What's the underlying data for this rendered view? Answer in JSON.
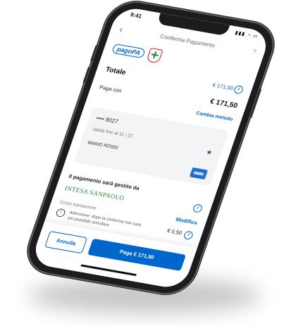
{
  "status": {
    "time": "9:41"
  },
  "nav": {
    "title": "Conferma Pagamento",
    "back_icon": "chevron-left-icon",
    "help": "?"
  },
  "logos": {
    "pagopa": "pagoPA"
  },
  "totale": {
    "label": "Totale",
    "amount": "€ 171,00"
  },
  "paga_con": {
    "label": "Paga con",
    "amount": "€ 171,50",
    "change_label": "Cambia metodo"
  },
  "card": {
    "number": "•••• 8027",
    "expiry": "Valida fino al 11 / 22",
    "holder": "MARIO ROSSI"
  },
  "gestito": {
    "label": "Il pagamento sarà gestito da",
    "bank": "INTESA SANPAOLO"
  },
  "costo": {
    "label": "Costo transazione",
    "edit_label": "Modifica",
    "fee": "€ 0,50"
  },
  "warning": {
    "text": "Attenzione: dopo la conferma non sarà più possibile annullare."
  },
  "footer": {
    "cancel_label": "Annulla",
    "pay_label": "Paga € 171,50"
  },
  "colors": {
    "accent": "#0066cc",
    "bank_green": "#1c8a3a"
  }
}
